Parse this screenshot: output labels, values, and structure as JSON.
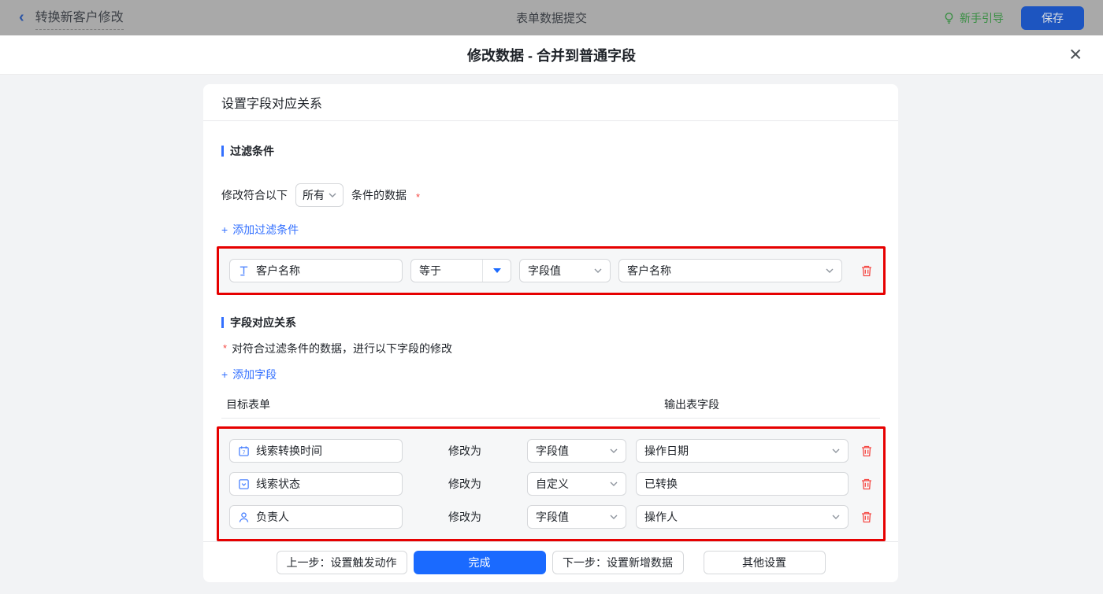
{
  "topbar": {
    "back_label": "转换新客户修改",
    "center_title": "表单数据提交",
    "guide_label": "新手引导",
    "save_label": "保存"
  },
  "dialog": {
    "title": "修改数据 - 合并到普通字段",
    "close_glyph": "✕"
  },
  "card": {
    "header": "设置字段对应关系",
    "filter": {
      "title": "过滤条件",
      "match_prefix": "修改符合以下",
      "match_select_value": "所有",
      "match_suffix": "条件的数据",
      "required_mark": "*",
      "add_icon": "+",
      "add_label": "添加过滤条件",
      "condition": {
        "field": "客户名称",
        "operator": "等于",
        "value_type": "字段值",
        "value": "客户名称"
      }
    },
    "mapping": {
      "title": "字段对应关系",
      "required_mark": "*",
      "description": "对符合过滤条件的数据，进行以下字段的修改",
      "add_icon": "+",
      "add_label": "添加字段",
      "col_target": "目标表单",
      "col_output": "输出表字段",
      "rows": [
        {
          "field": "线索转换时间",
          "modify_label": "修改为",
          "type": "字段值",
          "value": "操作日期"
        },
        {
          "field": "线索状态",
          "modify_label": "修改为",
          "type": "自定义",
          "value": "已转换"
        },
        {
          "field": "负责人",
          "modify_label": "修改为",
          "type": "字段值",
          "value": "操作人"
        }
      ]
    },
    "footer": {
      "prev_label": "上一步：设置触发动作",
      "done_label": "完成",
      "next_label": "下一步：设置新增数据",
      "other_label": "其他设置"
    }
  },
  "colors": {
    "primary_blue": "#1a6aff",
    "link_blue": "#3370ff",
    "icon_blue": "#4c83ff",
    "highlight_red": "#e60000",
    "danger_red": "#f54a45",
    "guide_green": "#3a8f44",
    "topbar_dimmed": "#a9a9a9"
  }
}
